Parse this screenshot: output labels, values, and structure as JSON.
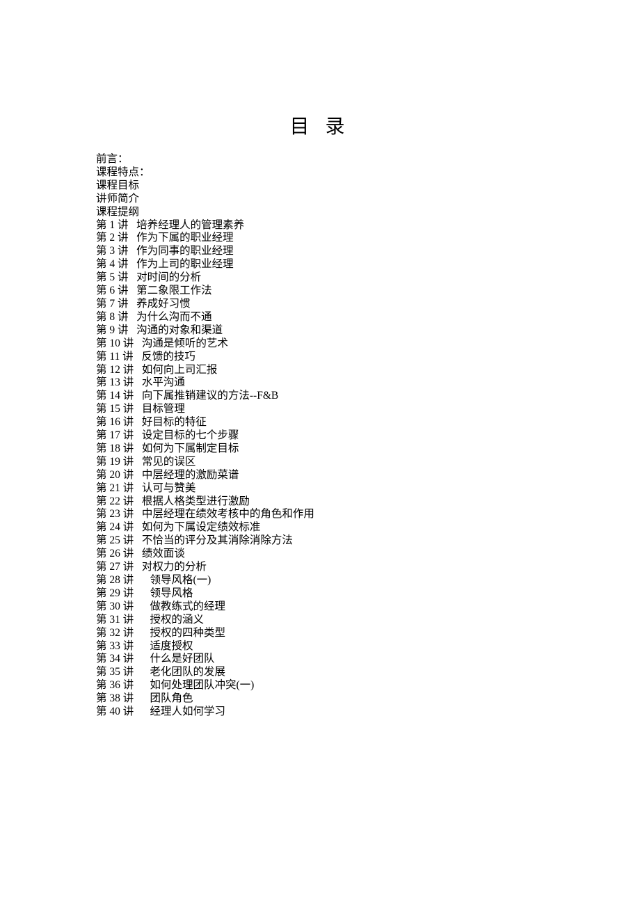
{
  "title": "目 录",
  "intro": [
    "前言：",
    "课程特点：",
    "课程目标",
    "讲师简介",
    "课程提纲"
  ],
  "lectures": [
    {
      "num": "第 1 讲",
      "gap": "   ",
      "title": "培养经理人的管理素养"
    },
    {
      "num": "第 2 讲",
      "gap": "   ",
      "title": "作为下属的职业经理"
    },
    {
      "num": "第 3 讲",
      "gap": "   ",
      "title": "作为同事的职业经理"
    },
    {
      "num": "第 4 讲",
      "gap": "   ",
      "title": "作为上司的职业经理"
    },
    {
      "num": "第 5 讲",
      "gap": "   ",
      "title": "对时间的分析"
    },
    {
      "num": "第 6 讲",
      "gap": "   ",
      "title": "第二象限工作法"
    },
    {
      "num": "第 7 讲",
      "gap": "   ",
      "title": "养成好习惯"
    },
    {
      "num": "第 8 讲",
      "gap": "   ",
      "title": "为什么沟而不通"
    },
    {
      "num": "第 9 讲",
      "gap": "   ",
      "title": "沟通的对象和渠道"
    },
    {
      "num": "第 10 讲",
      "gap": "   ",
      "title": "沟通是倾听的艺术"
    },
    {
      "num": "第 11 讲",
      "gap": "   ",
      "title": "反馈的技巧"
    },
    {
      "num": "第 12 讲",
      "gap": "   ",
      "title": "如何向上司汇报"
    },
    {
      "num": "第 13 讲",
      "gap": "   ",
      "title": "水平沟通"
    },
    {
      "num": "第 14 讲",
      "gap": "   ",
      "title": "向下属推销建议的方法--F&B"
    },
    {
      "num": "第 15 讲",
      "gap": "   ",
      "title": "目标管理"
    },
    {
      "num": "第 16 讲",
      "gap": "   ",
      "title": "好目标的特征"
    },
    {
      "num": "第 17 讲",
      "gap": "   ",
      "title": "设定目标的七个步骤"
    },
    {
      "num": "第 18 讲",
      "gap": "   ",
      "title": "如何为下属制定目标"
    },
    {
      "num": "第 19 讲",
      "gap": "   ",
      "title": "常见的误区"
    },
    {
      "num": "第 20 讲",
      "gap": "   ",
      "title": "中层经理的激励菜谱"
    },
    {
      "num": "第 21 讲",
      "gap": "   ",
      "title": "认可与赞美"
    },
    {
      "num": "第 22 讲",
      "gap": "   ",
      "title": "根据人格类型进行激励"
    },
    {
      "num": "第 23 讲",
      "gap": "   ",
      "title": "中层经理在绩效考核中的角色和作用"
    },
    {
      "num": "第 24 讲",
      "gap": "   ",
      "title": "如何为下属设定绩效标准"
    },
    {
      "num": "第 25 讲",
      "gap": "   ",
      "title": "不恰当的评分及其消除消除方法"
    },
    {
      "num": "第 26 讲",
      "gap": "   ",
      "title": "绩效面谈"
    },
    {
      "num": "第 27 讲",
      "gap": "   ",
      "title": "对权力的分析"
    },
    {
      "num": "第 28 讲",
      "gap": "      ",
      "title": "领导风格(一)"
    },
    {
      "num": "第 29 讲",
      "gap": "      ",
      "title": "领导风格"
    },
    {
      "num": "第 30 讲",
      "gap": "      ",
      "title": "做教练式的经理"
    },
    {
      "num": "第 31 讲",
      "gap": "      ",
      "title": "授权的涵义"
    },
    {
      "num": "第 32 讲",
      "gap": "      ",
      "title": "授权的四种类型"
    },
    {
      "num": "第 33 讲",
      "gap": "      ",
      "title": "适度授权"
    },
    {
      "num": "第 34 讲",
      "gap": "      ",
      "title": "什么是好团队"
    },
    {
      "num": "第 35 讲",
      "gap": "      ",
      "title": "老化团队的发展"
    },
    {
      "num": "第 36 讲",
      "gap": "      ",
      "title": "如何处理团队冲突(一)"
    },
    {
      "num": "第 38 讲",
      "gap": "      ",
      "title": "团队角色"
    },
    {
      "num": "第 40 讲",
      "gap": "      ",
      "title": "经理人如何学习"
    }
  ]
}
